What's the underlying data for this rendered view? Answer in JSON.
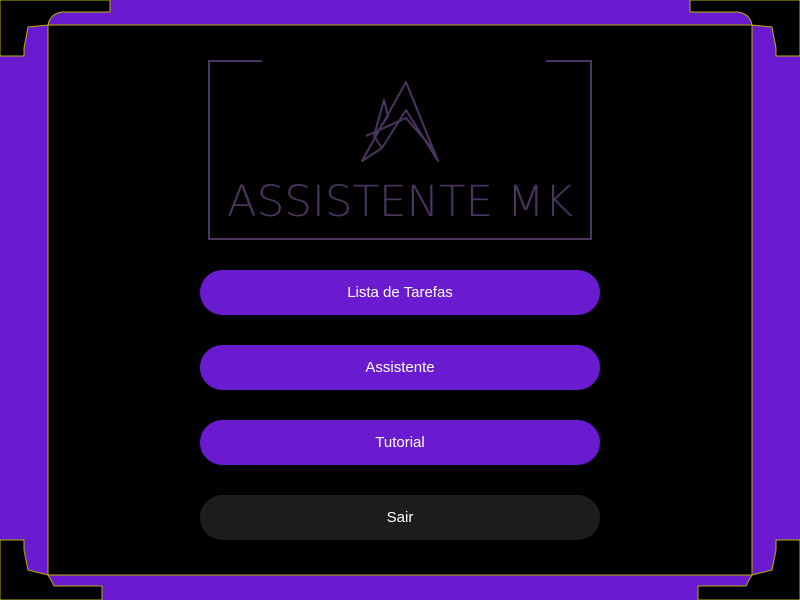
{
  "app": {
    "logo_text": "ASSISTENTE MK"
  },
  "menu": {
    "tasks_label": "Lista de Tarefas",
    "assistant_label": "Assistente",
    "tutorial_label": "Tutorial",
    "exit_label": "Sair"
  },
  "icons": {
    "logo_mark": "a-monogram-icon"
  },
  "colors": {
    "frame_purple": "#6a1bcf",
    "frame_outline": "#b8b000",
    "background": "#000000",
    "button_primary": "#6a1bcf",
    "button_exit": "#1c1c1c",
    "logo_stroke": "#4a3560",
    "button_text": "#ffffff"
  }
}
